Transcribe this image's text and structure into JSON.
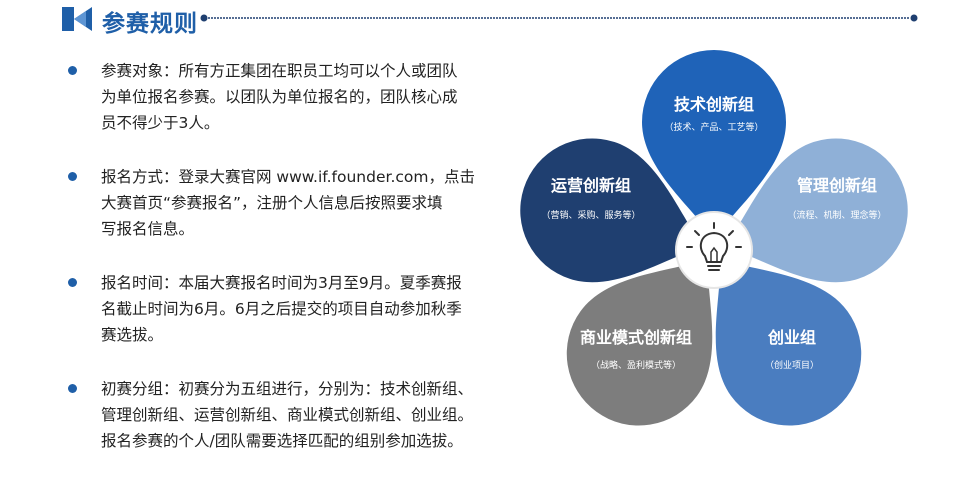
{
  "header": {
    "title": "参赛规则",
    "accent_color": "#1f5fa8",
    "logo_icon": "arrow-logo-icon"
  },
  "rules": [
    {
      "text": "参赛对象：所有方正集团在职员工均可以个人或团队\n为单位报名参赛。以团队为单位报名的，团队核心成\n员不得少于3人。"
    },
    {
      "text": "报名方式：登录大赛官网 www.if.founder.com，点击\n大赛首页“参赛报名”，注册个人信息后按照要求填\n写报名信息。"
    },
    {
      "text": "报名时间：本届大赛报名时间为3月至9月。夏季赛报\n名截止时间为6月。6月之后提交的项目自动参加秋季\n赛选拔。"
    },
    {
      "text": "初赛分组：初赛分为五组进行，分别为：技术创新组、\n管理创新组、运营创新组、商业模式创新组、创业组。\n报名参赛的个人/团队需要选择匹配的组别参加选拔。"
    }
  ],
  "diagram": {
    "center_icon": "lightbulb-icon",
    "groups": [
      {
        "name": "技术创新组",
        "desc": "（技术、产品、工艺等）",
        "color": "#1f63b8"
      },
      {
        "name": "管理创新组",
        "desc": "（流程、机制、理念等）",
        "color": "#8fb0d7"
      },
      {
        "name": "创业组",
        "desc": "（创业项目）",
        "color": "#4a7dc0"
      },
      {
        "name": "商业模式创新组",
        "desc": "（战略、盈利模式等）",
        "color": "#7d7d7d"
      },
      {
        "name": "运营创新组",
        "desc": "（营销、采购、服务等）",
        "color": "#1f3f70"
      }
    ]
  }
}
